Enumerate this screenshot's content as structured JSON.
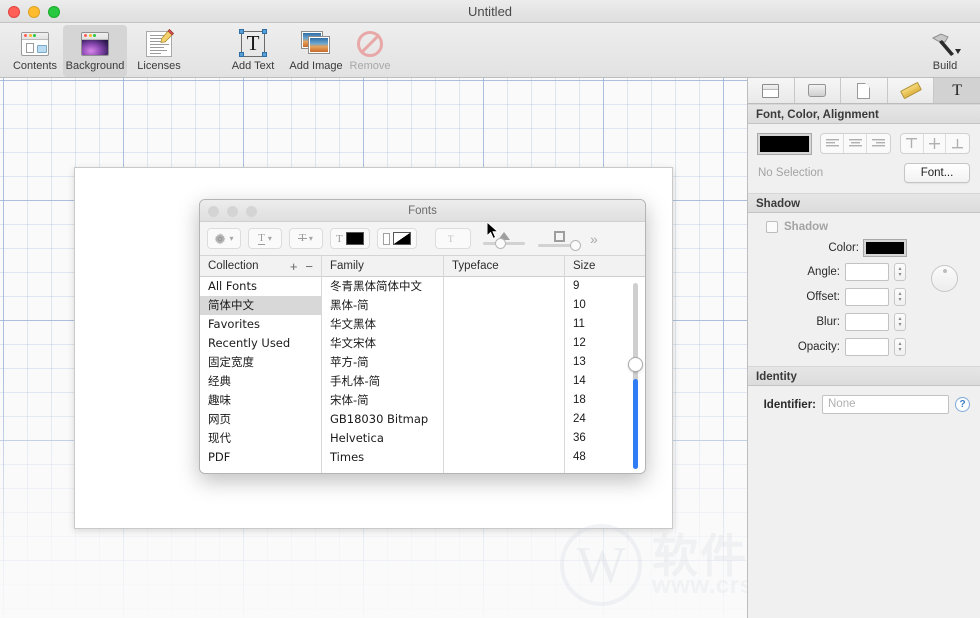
{
  "window": {
    "title": "Untitled",
    "traffic_lights": [
      "close",
      "minimize",
      "zoom"
    ]
  },
  "toolbar": {
    "items": [
      {
        "label": "Contents",
        "icon": "contents-icon",
        "selected": false,
        "enabled": true
      },
      {
        "label": "Background",
        "icon": "background-icon",
        "selected": true,
        "enabled": true
      },
      {
        "label": "Licenses",
        "icon": "licenses-icon",
        "selected": false,
        "enabled": true
      },
      {
        "label": "Add Text",
        "icon": "add-text-icon",
        "selected": false,
        "enabled": true
      },
      {
        "label": "Add Image",
        "icon": "add-image-icon",
        "selected": false,
        "enabled": true
      },
      {
        "label": "Remove",
        "icon": "remove-icon",
        "selected": false,
        "enabled": false
      }
    ],
    "build": {
      "label": "Build",
      "icon": "hammer-icon"
    }
  },
  "fonts_panel": {
    "title": "Fonts",
    "toolbar": {
      "gear": "gear-icon",
      "underline": "underline-icon",
      "strikethrough": "strikethrough-icon",
      "text_color": "text-color-icon",
      "document_color": "document-color-icon",
      "shadow_toggle": "shadow-toggle-icon",
      "shadow_blur_slider": "shadow-blur-slider",
      "shadow_offset_slider": "shadow-offset-slider",
      "overflow": "»"
    },
    "columns": [
      {
        "key": "collection",
        "header": "Collection"
      },
      {
        "key": "family",
        "header": "Family"
      },
      {
        "key": "typeface",
        "header": "Typeface"
      },
      {
        "key": "size",
        "header": "Size"
      }
    ],
    "add_label": "+",
    "remove_label": "−",
    "collection": {
      "items": [
        "All Fonts",
        "简体中文",
        "Favorites",
        "Recently Used",
        "固定宽度",
        "经典",
        "趣味",
        "网页",
        "现代",
        "PDF"
      ],
      "selected_index": 1
    },
    "family": {
      "items": [
        "冬青黑体简体中文",
        "黑体-简",
        "华文黑体",
        "华文宋体",
        "苹方-简",
        "手札体-简",
        "宋体-简",
        "GB18030 Bitmap",
        "Helvetica",
        "Times"
      ],
      "selected_index": -1
    },
    "typeface": {
      "items": []
    },
    "size": {
      "items": [
        "9",
        "10",
        "11",
        "12",
        "13",
        "14",
        "18",
        "24",
        "36",
        "48"
      ],
      "selected_index": -1
    }
  },
  "inspector": {
    "tabs": [
      {
        "icon": "window-icon",
        "active": false
      },
      {
        "icon": "disk-icon",
        "active": false
      },
      {
        "icon": "document-icon",
        "active": false
      },
      {
        "icon": "ruler-icon",
        "active": false
      },
      {
        "icon": "text-icon",
        "label": "T",
        "active": true
      }
    ],
    "font_section": {
      "header": "Font, Color, Alignment",
      "color_value": "#000000",
      "align_horizontal": [
        "align-left",
        "align-center",
        "align-right"
      ],
      "align_vertical": [
        "align-top",
        "align-middle",
        "align-bottom"
      ],
      "status": "No Selection",
      "font_button": "Font..."
    },
    "shadow_section": {
      "header": "Shadow",
      "checkbox_label": "Shadow",
      "checked": false,
      "fields": [
        {
          "label": "Color:",
          "value": "",
          "type": "color",
          "color_value": "#000000"
        },
        {
          "label": "Angle:",
          "value": "",
          "type": "stepper"
        },
        {
          "label": "Offset:",
          "value": "",
          "type": "stepper"
        },
        {
          "label": "Blur:",
          "value": "",
          "type": "stepper"
        },
        {
          "label": "Opacity:",
          "value": "",
          "type": "stepper"
        }
      ],
      "angle_dial": "angle-dial"
    },
    "identity_section": {
      "header": "Identity",
      "identifier_label": "Identifier:",
      "identifier_value": "",
      "identifier_placeholder": "None",
      "help": "?"
    }
  },
  "watermark": {
    "mark": "W",
    "text_cn": "软件园",
    "url": "www.crsoon.com"
  }
}
